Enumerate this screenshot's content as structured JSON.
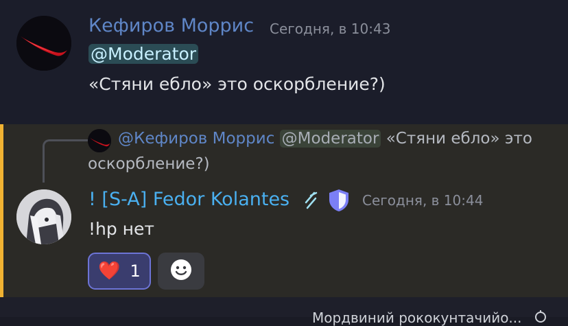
{
  "message1": {
    "author": "Кефиров Моррис",
    "timestamp": "Сегодня, в 10:43",
    "mention": "@Moderator",
    "text": "«Стяни ебло» это оскорбление?)",
    "author_color": "#5f86c7"
  },
  "message2": {
    "reply": {
      "author": "@Кефиров Моррис",
      "mention": "@Moderator",
      "text_line1": "«Стяни ебло» это",
      "text_line2": "оскорбление?)"
    },
    "author": "! [S-A] Fedor Kolantes",
    "author_color": "#4ab0f0",
    "timestamp": "Сегодня, в 10:44",
    "text": "!hp нет",
    "reactions": [
      {
        "emoji": "❤️",
        "count": "1",
        "selected": true
      }
    ],
    "highlight_color": "#f0b232"
  },
  "footer": {
    "typing_text": "Мордвиний рококунтачийо..."
  },
  "icons": [
    "avatar-red-eye",
    "link-badge-icon",
    "moderator-shield-icon",
    "add-reaction-icon",
    "timer-icon"
  ]
}
